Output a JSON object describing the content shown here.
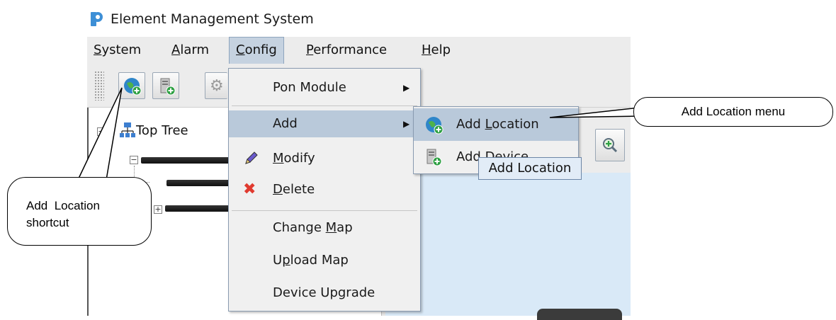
{
  "window": {
    "title": "Element Management System"
  },
  "menubar": {
    "items": [
      {
        "id": "system",
        "label": "System",
        "mnemonic": "S"
      },
      {
        "id": "alarm",
        "label": "Alarm",
        "mnemonic": "A"
      },
      {
        "id": "config",
        "label": "Config",
        "mnemonic": "C"
      },
      {
        "id": "performance",
        "label": "Performance",
        "mnemonic": "P"
      },
      {
        "id": "help",
        "label": "Help",
        "mnemonic": "H"
      }
    ]
  },
  "tree": {
    "root_label": "Top Tree"
  },
  "config_menu": {
    "pon_module": "Pon Module",
    "add": "Add",
    "modify": "Modify",
    "delete": "Delete",
    "change_map": "Change Map",
    "upload_map": "Upload Map",
    "device_upgrade": "Device Upgrade"
  },
  "add_submenu": {
    "add_location": "Add Location",
    "add_device": "Add Device"
  },
  "tooltip": "Add Location",
  "callouts": {
    "menu": "Add Location menu",
    "shortcut_line1": "Add  Location",
    "shortcut_line2": "shortcut"
  },
  "colors": {
    "menu_highlight": "#b9c9da",
    "menubar_selected": "#c5d2e0",
    "map_background": "#d9e9f7",
    "delete_icon": "#e03a2f"
  },
  "icons": {
    "app": "app-logo-icon",
    "add_location": "globe-plus-icon",
    "add_device": "device-plus-icon",
    "modify": "pencil-icon",
    "delete": "red-x-icon"
  }
}
